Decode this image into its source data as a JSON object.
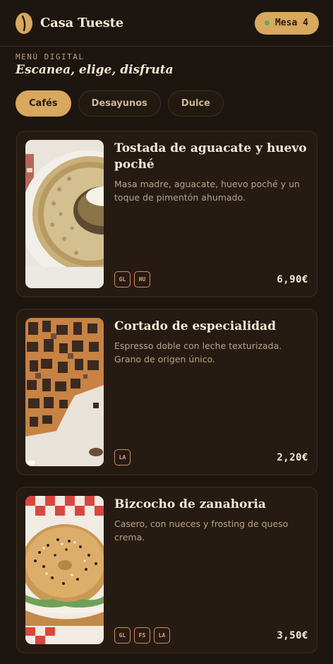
{
  "header": {
    "brand": "Casa Tueste",
    "table_label": "Mesa 4"
  },
  "intro": {
    "eyebrow": "MENÚ DIGITAL",
    "tagline": "Escanea, elige, disfruta"
  },
  "tabs": [
    {
      "label": "Cafés",
      "active": true
    },
    {
      "label": "Desayunos",
      "active": false
    },
    {
      "label": "Dulce",
      "active": false
    }
  ],
  "items": [
    {
      "title": "Tostada de aguacate y huevo poché",
      "description": "Masa madre, aguacate, huevo poché y un toque de pimentón ahumado.",
      "badges": [
        "GL",
        "HU"
      ],
      "price": "6,90€",
      "photo": "toast-plate-photo"
    },
    {
      "title": "Cortado de especialidad",
      "description": "Espresso doble con leche texturizada. Grano de origen único.",
      "badges": [
        "LA"
      ],
      "price": "2,20€",
      "photo": "cafe-wall-photo"
    },
    {
      "title": "Bizcocho de zanahoria",
      "description": "Casero, con nueces y frosting de queso crema.",
      "badges": [
        "GL",
        "FS",
        "LA"
      ],
      "price": "3,50€",
      "photo": "bagel-photo"
    }
  ],
  "colors": {
    "background": "#1d150f",
    "card": "#261b13",
    "accent": "#d7a85d",
    "badge": "#d58a5a",
    "status_dot": "#5fae5a"
  }
}
